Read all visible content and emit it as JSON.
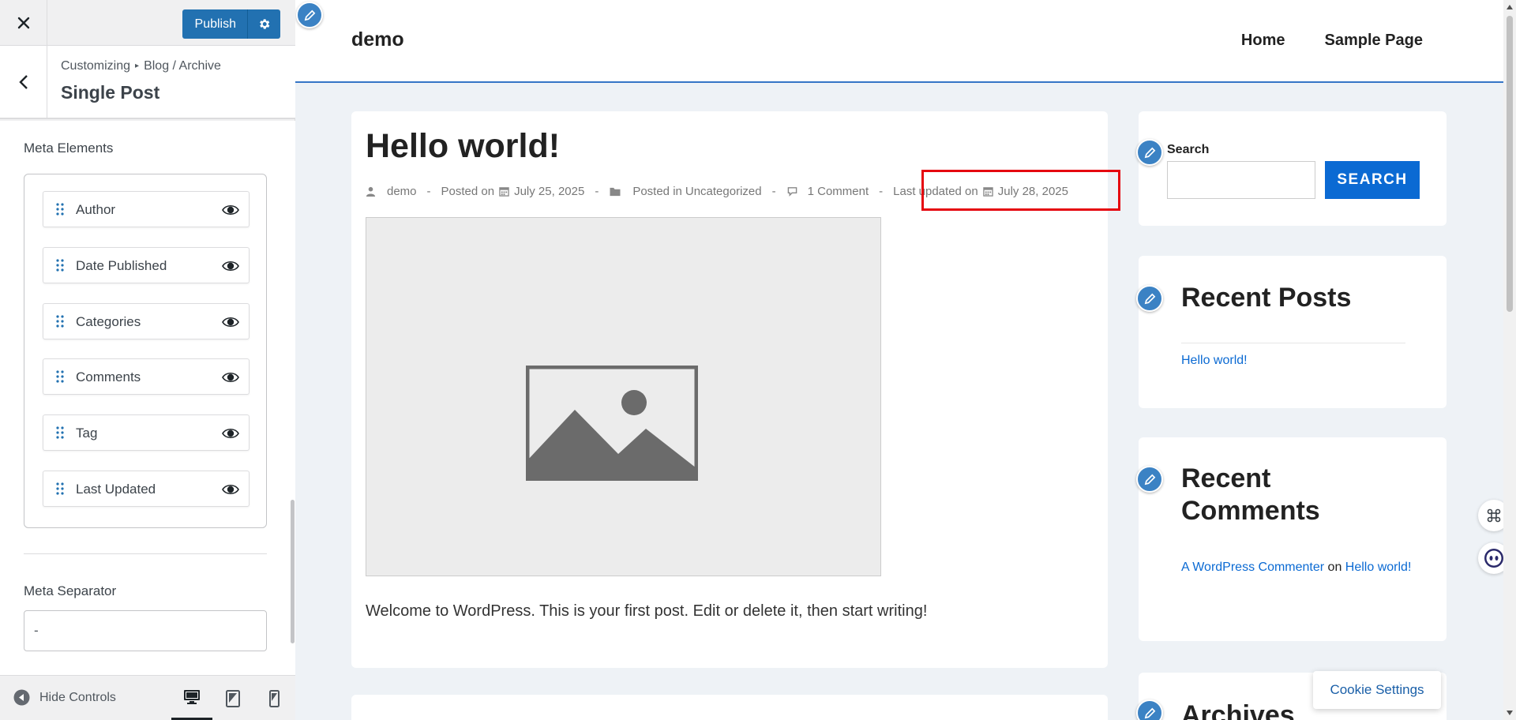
{
  "customizer": {
    "publish_label": "Publish",
    "breadcrumb_root": "Customizing",
    "breadcrumb_parent": "Blog / Archive",
    "panel_title": "Single Post",
    "meta_elements_label": "Meta Elements",
    "meta_items": [
      {
        "label": "Author",
        "visible": true
      },
      {
        "label": "Date Published",
        "visible": true
      },
      {
        "label": "Categories",
        "visible": true
      },
      {
        "label": "Comments",
        "visible": true
      },
      {
        "label": "Tag",
        "visible": true
      },
      {
        "label": "Last Updated",
        "visible": true
      }
    ],
    "meta_separator_label": "Meta Separator",
    "meta_separator_value": "-",
    "hide_controls_label": "Hide Controls",
    "active_device": "desktop"
  },
  "preview": {
    "site_title": "demo",
    "nav": [
      "Home",
      "Sample Page"
    ],
    "post": {
      "title": "Hello world!",
      "author": "demo",
      "posted_on_label": "Posted on",
      "posted_date": "July 25, 2025",
      "posted_in_label": "Posted in",
      "category": "Uncategorized",
      "comments": "1 Comment",
      "last_updated_label": "Last updated on",
      "last_updated_date": "July 28, 2025",
      "separator": "-",
      "excerpt": "Welcome to WordPress. This is your first post. Edit or delete it, then start writing!"
    },
    "sidebar": {
      "search_label": "Search",
      "search_value": "",
      "search_button": "SEARCH",
      "recent_posts_heading": "Recent Posts",
      "recent_posts": [
        "Hello world!"
      ],
      "recent_comments_heading": "Recent Comments",
      "comment_author": "A WordPress Commenter",
      "comment_on": "on",
      "comment_post": "Hello world!",
      "archives_heading": "Archives"
    },
    "cookie_settings": "Cookie Settings"
  },
  "colors": {
    "accent": "#2271b1",
    "link": "#0b6ad3",
    "highlight": "#e5060f",
    "edit_shortcut": "#3b82c4"
  },
  "icons": [
    "close-icon",
    "gear-icon",
    "chevron-left-icon",
    "drag-handle-icon",
    "eye-icon",
    "pencil-icon",
    "user-icon",
    "calendar-icon",
    "folder-icon",
    "comment-icon",
    "image-placeholder-icon",
    "desktop-icon",
    "tablet-icon",
    "mobile-icon",
    "play-back-icon"
  ]
}
